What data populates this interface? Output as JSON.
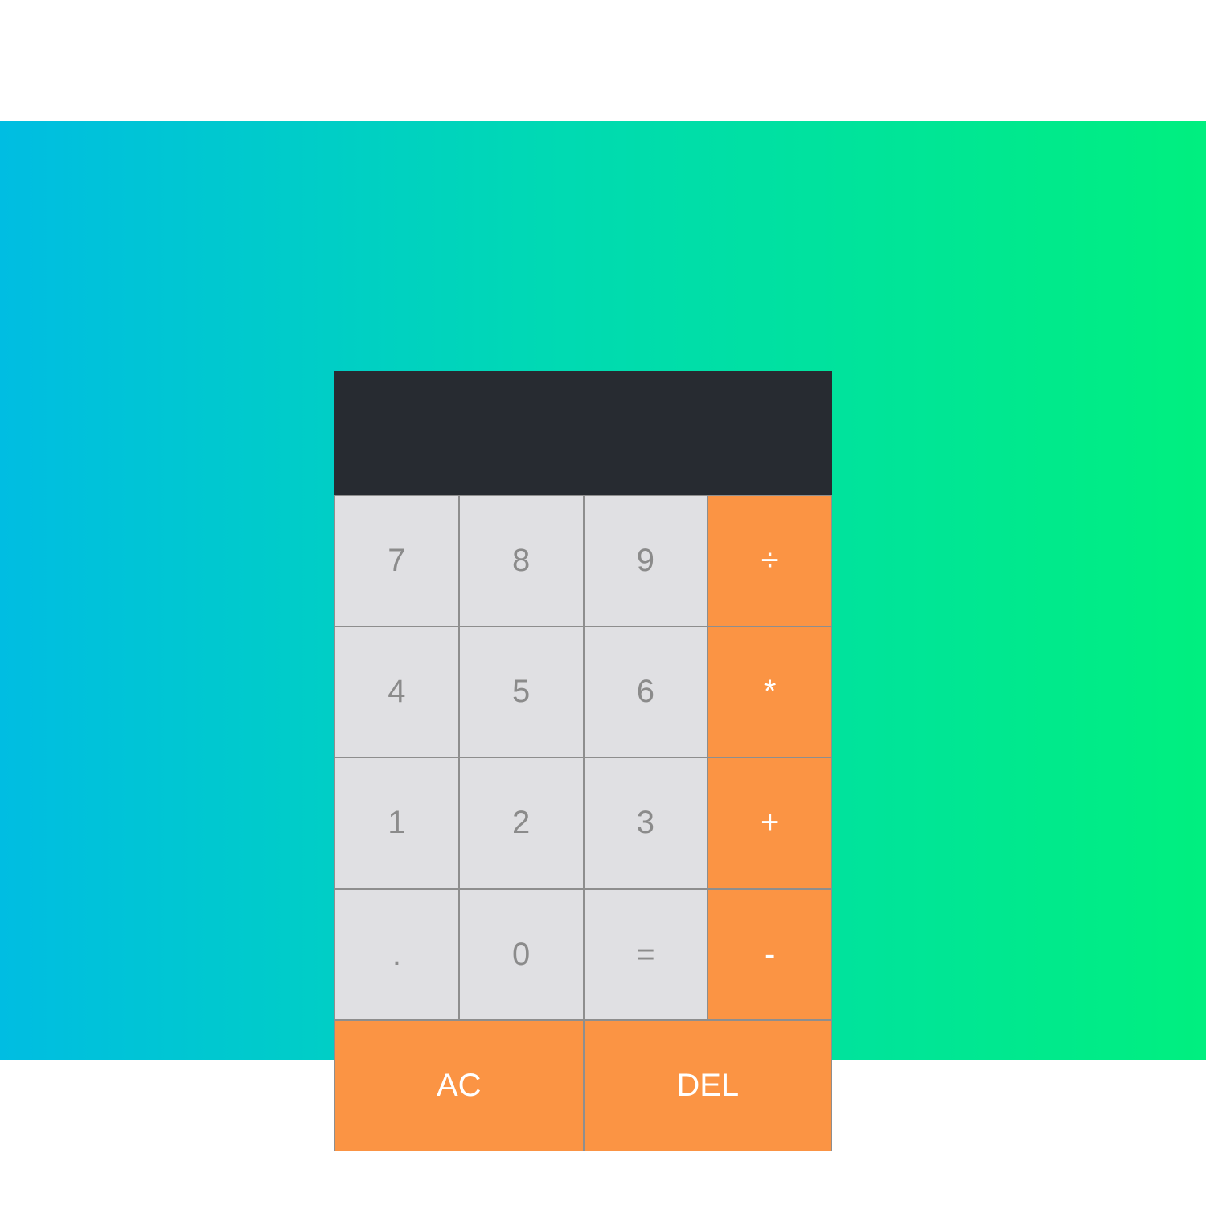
{
  "display": {
    "previous_operand": "",
    "current_operand": ""
  },
  "keys": {
    "row1": [
      "7",
      "8",
      "9",
      "÷"
    ],
    "row2": [
      "4",
      "5",
      "6",
      "*"
    ],
    "row3": [
      "1",
      "2",
      "3",
      "+"
    ],
    "row4": [
      ".",
      "0",
      "=",
      "-"
    ],
    "row5": [
      "AC",
      "DEL"
    ]
  },
  "colors": {
    "gradient_start": "#00bde2",
    "gradient_end": "#00ef7f",
    "display_bg": "#272b31",
    "number_key_bg": "#e0e0e3",
    "number_key_text": "#8b8b8b",
    "operator_key_bg": "#fb9444",
    "operator_key_text": "#ffffff"
  }
}
